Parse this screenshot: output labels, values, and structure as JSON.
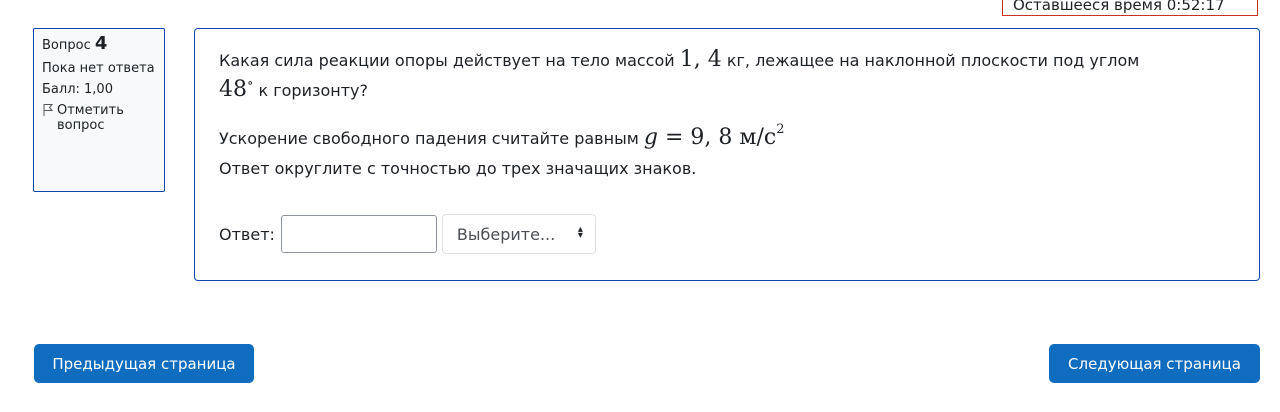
{
  "timer": {
    "text": "Оставшееся время 0:52:17"
  },
  "info": {
    "question_word": "Вопрос",
    "question_number": "4",
    "state": "Пока нет ответа",
    "grade": "Балл: 1,00",
    "flag_label": "Отметить вопрос"
  },
  "question": {
    "line1_prefix": "Какая сила реакции опоры действует на тело массой ",
    "mass": "1, 4",
    "line1_suffix": " кг, лежащее на наклонной плоскости под углом",
    "angle": "48",
    "degree_sign": "∘",
    "line2_suffix": " к горизонту?",
    "g_prefix": "Ускорение свободного падения считайте равным ",
    "g_symbol": "g",
    "g_equals": " = 9, 8 ",
    "g_unit": "м/с",
    "g_power": "2",
    "round_text": "Ответ округлите  с точностью до трех значащих знаков."
  },
  "answer": {
    "label": "Ответ:",
    "input_value": "",
    "select_value": "Выберите...",
    "select_icon": "updown-arrows-icon"
  },
  "nav": {
    "prev_label": "Предыдущая страница",
    "next_label": "Следующая страница"
  },
  "colors": {
    "primary": "#0f6cbf",
    "border_blue": "#0f47ad",
    "timer_border": "#ca3120"
  }
}
